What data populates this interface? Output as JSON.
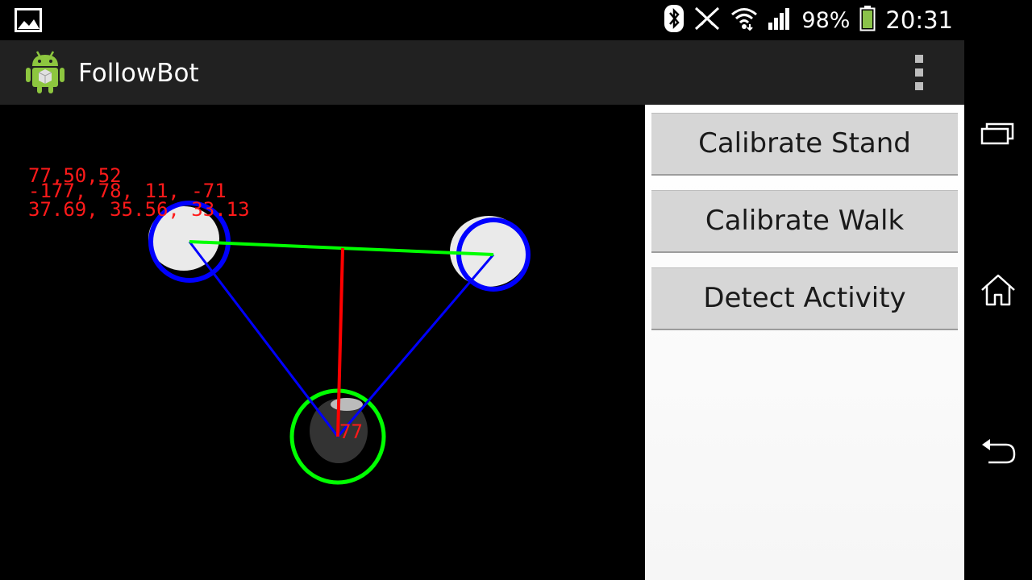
{
  "status_bar": {
    "notification_icon": "picture-icon",
    "icons": [
      "bluetooth-icon",
      "nfc-off-icon",
      "wifi-icon",
      "signal-icon"
    ],
    "battery_percent": "98%",
    "battery_icon": "battery-icon",
    "time": "20:31"
  },
  "action_bar": {
    "app_icon": "android-app-icon",
    "title": "FollowBot",
    "overflow_icon": "overflow-menu-icon"
  },
  "camera_overlay": {
    "line1": "77,50,52",
    "line2": "-177, 78, 11, -71",
    "line3": "37.69, 35.56, 33.13",
    "angle_label": "77",
    "colors": {
      "text": "#ff1a1a",
      "triangle": "#0000ff",
      "baseline": "#00ff00",
      "height_line": "#ff0000",
      "bottom_circle": "#00ff00",
      "top_circles": "#0000ff"
    }
  },
  "side_panel": {
    "buttons": [
      {
        "label": "Calibrate Stand"
      },
      {
        "label": "Calibrate Walk"
      },
      {
        "label": "Detect Activity"
      }
    ]
  },
  "nav_bar": {
    "icons": [
      "recent-apps-icon",
      "home-icon",
      "back-icon"
    ]
  }
}
